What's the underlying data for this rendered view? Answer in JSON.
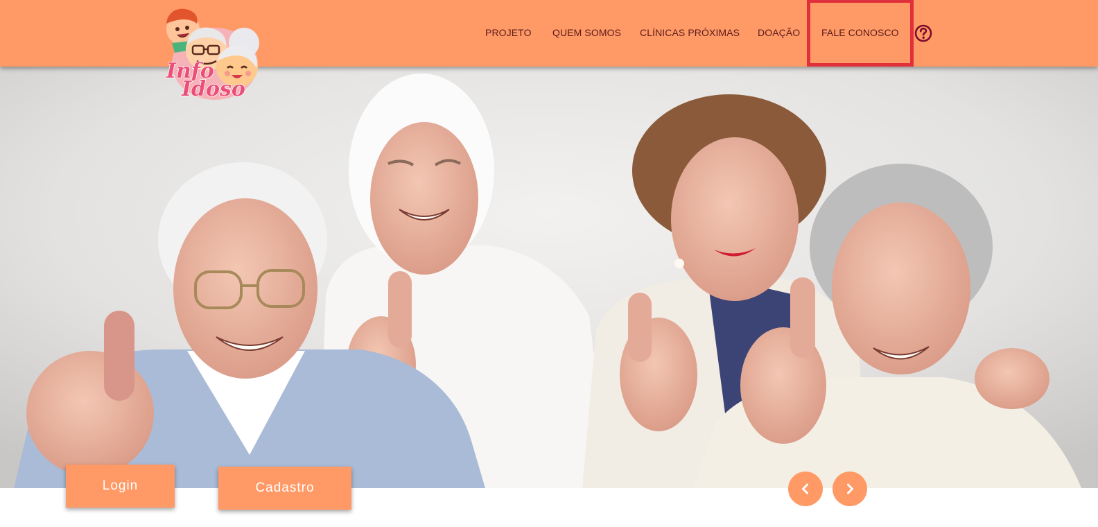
{
  "brand": {
    "logo_text_line1": "Info",
    "logo_text_line2": "Idoso"
  },
  "nav": {
    "items": [
      {
        "label": "PROJETO"
      },
      {
        "label": "QUEM SOMOS"
      },
      {
        "label": "CLÍNICAS PRÓXIMAS"
      },
      {
        "label": "DOAÇÃO"
      },
      {
        "label": "FALE CONOSCO",
        "highlighted": true
      }
    ],
    "help_icon": "question-circle-icon"
  },
  "hero": {
    "image_subject": "four smiling elderly people giving thumbs up"
  },
  "actions": {
    "login_label": "Login",
    "cadastro_label": "Cadastro"
  },
  "carousel": {
    "prev_icon": "chevron-left-icon",
    "next_icon": "chevron-right-icon"
  },
  "colors": {
    "header_bg": "#ff9966",
    "nav_text": "#5a1a1a",
    "highlight_border": "#e0303c",
    "button_bg": "#ff9966",
    "button_text": "#ffffff"
  }
}
